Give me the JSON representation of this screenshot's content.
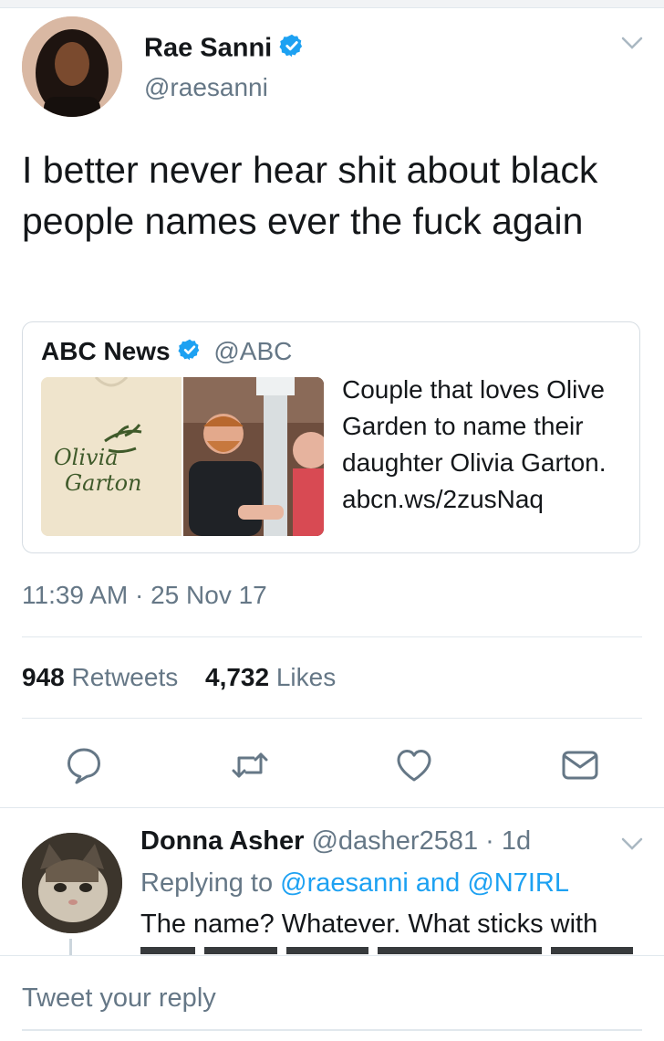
{
  "tweet": {
    "author_name": "Rae Sanni",
    "author_handle": "@raesanni",
    "text": "I better never hear shit about black people names ever the fuck again",
    "timestamp": "11:39 AM · 25 Nov 17",
    "retweets_count": "948",
    "retweets_label": "Retweets",
    "likes_count": "4,732",
    "likes_label": "Likes"
  },
  "quote": {
    "author_name": "ABC News",
    "author_handle": "@ABC",
    "text": "Couple that loves Olive Garden to name their daughter Olivia Garton. abcn.ws/2zusNaq",
    "image_onesie_text_line1": "Olivia",
    "image_onesie_text_line2": "Garton"
  },
  "reply": {
    "author_name": "Donna Asher",
    "author_handle": "@dasher2581",
    "time": "· 1d",
    "replying_prefix": "Replying to",
    "replying_user1": "@raesanni",
    "replying_and": "and",
    "replying_user2": "@N7IRL",
    "text": "The name? Whatever. What sticks with"
  },
  "composer": {
    "placeholder": "Tweet your reply"
  },
  "colors": {
    "accent": "#1da1f2",
    "secondary_text": "#657786",
    "primary_text": "#14171a"
  },
  "icons": [
    "verified-badge-icon",
    "chevron-down-icon",
    "reply-icon",
    "retweet-icon",
    "like-icon",
    "share-icon"
  ]
}
